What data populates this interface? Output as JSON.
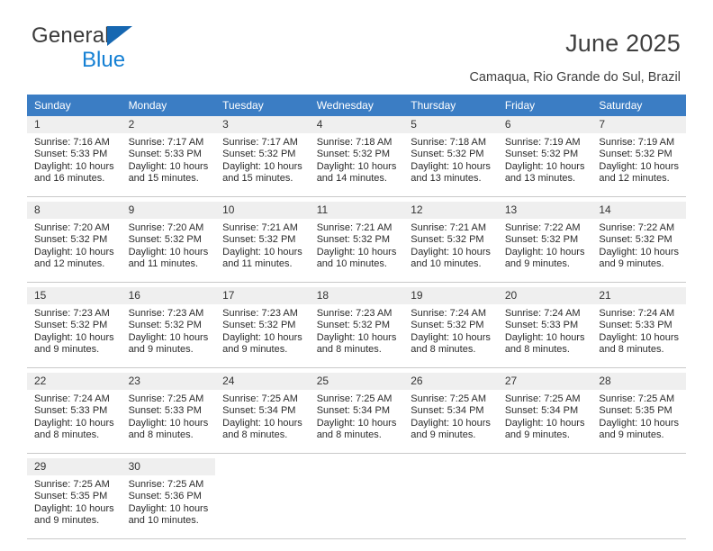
{
  "brand": {
    "name_line1": "General",
    "name_line2": "Blue",
    "accent_color": "#1580d4",
    "triangle_color": "#1667b1"
  },
  "header": {
    "title": "June 2025",
    "subtitle": "Camaqua, Rio Grande do Sul, Brazil",
    "header_bg_color": "#3b7dc4",
    "daynum_bg_color": "#efefef"
  },
  "weekdays": [
    "Sunday",
    "Monday",
    "Tuesday",
    "Wednesday",
    "Thursday",
    "Friday",
    "Saturday"
  ],
  "weeks": [
    [
      {
        "day": "1",
        "sunrise": "Sunrise: 7:16 AM",
        "sunset": "Sunset: 5:33 PM",
        "daylight1": "Daylight: 10 hours",
        "daylight2": "and 16 minutes."
      },
      {
        "day": "2",
        "sunrise": "Sunrise: 7:17 AM",
        "sunset": "Sunset: 5:33 PM",
        "daylight1": "Daylight: 10 hours",
        "daylight2": "and 15 minutes."
      },
      {
        "day": "3",
        "sunrise": "Sunrise: 7:17 AM",
        "sunset": "Sunset: 5:32 PM",
        "daylight1": "Daylight: 10 hours",
        "daylight2": "and 15 minutes."
      },
      {
        "day": "4",
        "sunrise": "Sunrise: 7:18 AM",
        "sunset": "Sunset: 5:32 PM",
        "daylight1": "Daylight: 10 hours",
        "daylight2": "and 14 minutes."
      },
      {
        "day": "5",
        "sunrise": "Sunrise: 7:18 AM",
        "sunset": "Sunset: 5:32 PM",
        "daylight1": "Daylight: 10 hours",
        "daylight2": "and 13 minutes."
      },
      {
        "day": "6",
        "sunrise": "Sunrise: 7:19 AM",
        "sunset": "Sunset: 5:32 PM",
        "daylight1": "Daylight: 10 hours",
        "daylight2": "and 13 minutes."
      },
      {
        "day": "7",
        "sunrise": "Sunrise: 7:19 AM",
        "sunset": "Sunset: 5:32 PM",
        "daylight1": "Daylight: 10 hours",
        "daylight2": "and 12 minutes."
      }
    ],
    [
      {
        "day": "8",
        "sunrise": "Sunrise: 7:20 AM",
        "sunset": "Sunset: 5:32 PM",
        "daylight1": "Daylight: 10 hours",
        "daylight2": "and 12 minutes."
      },
      {
        "day": "9",
        "sunrise": "Sunrise: 7:20 AM",
        "sunset": "Sunset: 5:32 PM",
        "daylight1": "Daylight: 10 hours",
        "daylight2": "and 11 minutes."
      },
      {
        "day": "10",
        "sunrise": "Sunrise: 7:21 AM",
        "sunset": "Sunset: 5:32 PM",
        "daylight1": "Daylight: 10 hours",
        "daylight2": "and 11 minutes."
      },
      {
        "day": "11",
        "sunrise": "Sunrise: 7:21 AM",
        "sunset": "Sunset: 5:32 PM",
        "daylight1": "Daylight: 10 hours",
        "daylight2": "and 10 minutes."
      },
      {
        "day": "12",
        "sunrise": "Sunrise: 7:21 AM",
        "sunset": "Sunset: 5:32 PM",
        "daylight1": "Daylight: 10 hours",
        "daylight2": "and 10 minutes."
      },
      {
        "day": "13",
        "sunrise": "Sunrise: 7:22 AM",
        "sunset": "Sunset: 5:32 PM",
        "daylight1": "Daylight: 10 hours",
        "daylight2": "and 9 minutes."
      },
      {
        "day": "14",
        "sunrise": "Sunrise: 7:22 AM",
        "sunset": "Sunset: 5:32 PM",
        "daylight1": "Daylight: 10 hours",
        "daylight2": "and 9 minutes."
      }
    ],
    [
      {
        "day": "15",
        "sunrise": "Sunrise: 7:23 AM",
        "sunset": "Sunset: 5:32 PM",
        "daylight1": "Daylight: 10 hours",
        "daylight2": "and 9 minutes."
      },
      {
        "day": "16",
        "sunrise": "Sunrise: 7:23 AM",
        "sunset": "Sunset: 5:32 PM",
        "daylight1": "Daylight: 10 hours",
        "daylight2": "and 9 minutes."
      },
      {
        "day": "17",
        "sunrise": "Sunrise: 7:23 AM",
        "sunset": "Sunset: 5:32 PM",
        "daylight1": "Daylight: 10 hours",
        "daylight2": "and 9 minutes."
      },
      {
        "day": "18",
        "sunrise": "Sunrise: 7:23 AM",
        "sunset": "Sunset: 5:32 PM",
        "daylight1": "Daylight: 10 hours",
        "daylight2": "and 8 minutes."
      },
      {
        "day": "19",
        "sunrise": "Sunrise: 7:24 AM",
        "sunset": "Sunset: 5:32 PM",
        "daylight1": "Daylight: 10 hours",
        "daylight2": "and 8 minutes."
      },
      {
        "day": "20",
        "sunrise": "Sunrise: 7:24 AM",
        "sunset": "Sunset: 5:33 PM",
        "daylight1": "Daylight: 10 hours",
        "daylight2": "and 8 minutes."
      },
      {
        "day": "21",
        "sunrise": "Sunrise: 7:24 AM",
        "sunset": "Sunset: 5:33 PM",
        "daylight1": "Daylight: 10 hours",
        "daylight2": "and 8 minutes."
      }
    ],
    [
      {
        "day": "22",
        "sunrise": "Sunrise: 7:24 AM",
        "sunset": "Sunset: 5:33 PM",
        "daylight1": "Daylight: 10 hours",
        "daylight2": "and 8 minutes."
      },
      {
        "day": "23",
        "sunrise": "Sunrise: 7:25 AM",
        "sunset": "Sunset: 5:33 PM",
        "daylight1": "Daylight: 10 hours",
        "daylight2": "and 8 minutes."
      },
      {
        "day": "24",
        "sunrise": "Sunrise: 7:25 AM",
        "sunset": "Sunset: 5:34 PM",
        "daylight1": "Daylight: 10 hours",
        "daylight2": "and 8 minutes."
      },
      {
        "day": "25",
        "sunrise": "Sunrise: 7:25 AM",
        "sunset": "Sunset: 5:34 PM",
        "daylight1": "Daylight: 10 hours",
        "daylight2": "and 8 minutes."
      },
      {
        "day": "26",
        "sunrise": "Sunrise: 7:25 AM",
        "sunset": "Sunset: 5:34 PM",
        "daylight1": "Daylight: 10 hours",
        "daylight2": "and 9 minutes."
      },
      {
        "day": "27",
        "sunrise": "Sunrise: 7:25 AM",
        "sunset": "Sunset: 5:34 PM",
        "daylight1": "Daylight: 10 hours",
        "daylight2": "and 9 minutes."
      },
      {
        "day": "28",
        "sunrise": "Sunrise: 7:25 AM",
        "sunset": "Sunset: 5:35 PM",
        "daylight1": "Daylight: 10 hours",
        "daylight2": "and 9 minutes."
      }
    ],
    [
      {
        "day": "29",
        "sunrise": "Sunrise: 7:25 AM",
        "sunset": "Sunset: 5:35 PM",
        "daylight1": "Daylight: 10 hours",
        "daylight2": "and 9 minutes."
      },
      {
        "day": "30",
        "sunrise": "Sunrise: 7:25 AM",
        "sunset": "Sunset: 5:36 PM",
        "daylight1": "Daylight: 10 hours",
        "daylight2": "and 10 minutes."
      },
      {
        "day": "",
        "sunrise": "",
        "sunset": "",
        "daylight1": "",
        "daylight2": ""
      },
      {
        "day": "",
        "sunrise": "",
        "sunset": "",
        "daylight1": "",
        "daylight2": ""
      },
      {
        "day": "",
        "sunrise": "",
        "sunset": "",
        "daylight1": "",
        "daylight2": ""
      },
      {
        "day": "",
        "sunrise": "",
        "sunset": "",
        "daylight1": "",
        "daylight2": ""
      },
      {
        "day": "",
        "sunrise": "",
        "sunset": "",
        "daylight1": "",
        "daylight2": ""
      }
    ]
  ]
}
